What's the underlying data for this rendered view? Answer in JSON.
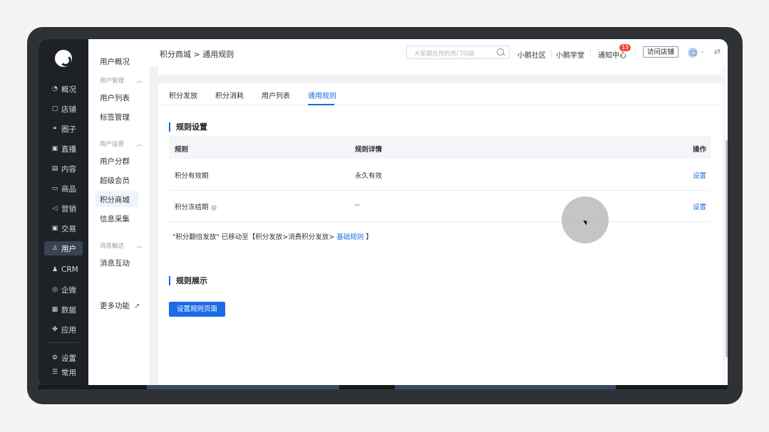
{
  "nav": {
    "items": [
      {
        "label": "概况",
        "icon": "overview-icon",
        "glyph": "◔"
      },
      {
        "label": "店铺",
        "icon": "store-icon",
        "glyph": "▢"
      },
      {
        "label": "圈子",
        "icon": "circle-icon",
        "glyph": "⚭"
      },
      {
        "label": "直播",
        "icon": "live-icon",
        "glyph": "▣"
      },
      {
        "label": "内容",
        "icon": "content-icon",
        "glyph": "▤"
      },
      {
        "label": "商品",
        "icon": "goods-icon",
        "glyph": "▭"
      },
      {
        "label": "营销",
        "icon": "marketing-icon",
        "glyph": "◁"
      },
      {
        "label": "交易",
        "icon": "trade-icon",
        "glyph": "▣"
      },
      {
        "label": "用户",
        "icon": "user-icon",
        "glyph": "♙",
        "active": true
      },
      {
        "label": "CRM",
        "icon": "crm-icon",
        "glyph": "♟"
      },
      {
        "label": "企微",
        "icon": "wecom-icon",
        "glyph": "◎"
      },
      {
        "label": "数据",
        "icon": "data-icon",
        "glyph": "▦"
      },
      {
        "label": "应用",
        "icon": "apps-icon",
        "glyph": "✤"
      },
      {
        "label": "设置",
        "icon": "settings-icon",
        "glyph": "⚙"
      },
      {
        "label": "常用",
        "icon": "frequent-icon",
        "glyph": "☰"
      }
    ]
  },
  "submenu": {
    "overview": "用户概况",
    "group_user_manage": "用户管理",
    "user_list": "用户列表",
    "tag_manage": "标签管理",
    "group_user_ops": "用户运营",
    "user_segment": "用户分群",
    "super_member": "超级会员",
    "points_mall": "积分商城",
    "info_collect": "信息采集",
    "group_msg": "消息触达",
    "msg_interact": "消息互动",
    "more": "更多功能"
  },
  "header": {
    "breadcrumb": "积分商城 > 通用规则",
    "search_placeholder": "大家都在用的热门功能",
    "community": "小鹅社区",
    "school": "小鹅学堂",
    "notify": "通知中心",
    "notify_count": "13",
    "visit_store": "访问店铺"
  },
  "tabs": [
    "积分发放",
    "积分消耗",
    "用户列表",
    "通用规则"
  ],
  "active_tab": 3,
  "rules": {
    "section_title": "规则设置",
    "columns": {
      "rule": "规则",
      "detail": "规则详情",
      "action": "操作"
    },
    "rows": [
      {
        "rule": "积分有效期",
        "detail": "永久有效",
        "action": "设置"
      },
      {
        "rule": "积分冻结期",
        "detail": "--",
        "action": "设置"
      }
    ],
    "note_prefix": "\"积分翻倍发放\" 已移动至【积分发放>消费积分发放> ",
    "note_link": "基础规则",
    "note_suffix": " 】"
  },
  "display": {
    "section_title": "规则展示",
    "button": "设置规则页面"
  }
}
